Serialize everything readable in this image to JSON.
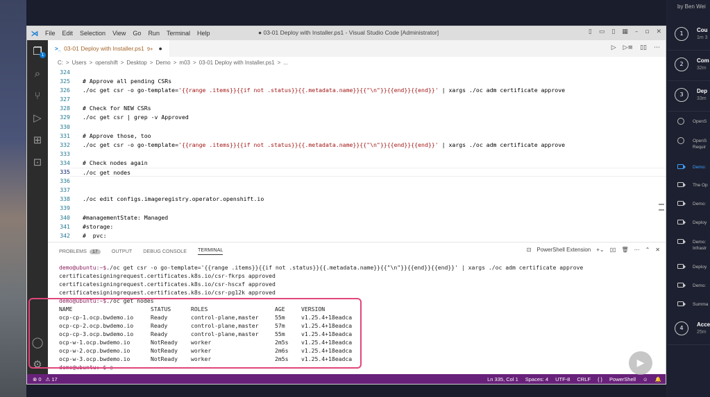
{
  "window": {
    "title": "● 03-01 Deploy with Installer.ps1 - Visual Studio Code [Administrator]",
    "menu": [
      "File",
      "Edit",
      "Selection",
      "View",
      "Go",
      "Run",
      "Terminal",
      "Help"
    ]
  },
  "tab": {
    "label": "03-01 Deploy with Installer.ps1",
    "problem_count": "9+",
    "modified_dot": "●"
  },
  "breadcrumb": [
    "C:",
    ">",
    "Users",
    ">",
    "openshift",
    ">",
    "Desktop",
    ">",
    "Demo",
    ">",
    "m03",
    ">",
    "03-01 Deploy with Installer.ps1",
    ">",
    "..."
  ],
  "editor": {
    "lines": [
      {
        "n": "324",
        "text": "",
        "kind": "plain"
      },
      {
        "n": "325",
        "text": "# Approve all pending CSRs",
        "kind": "comment"
      },
      {
        "n": "326",
        "pre": "./oc get csr -o go-template=",
        "str": "'{{range .items}}{{if not .status}}{{.metadata.name}}{{\"\\n\"}}{{end}}{{end}}'",
        "post": " | xargs ./oc adm certificate approve",
        "kind": "mixed"
      },
      {
        "n": "327",
        "text": "",
        "kind": "plain"
      },
      {
        "n": "328",
        "text": "# Check for NEW CSRs",
        "kind": "comment"
      },
      {
        "n": "329",
        "text": "./oc get csr | grep -v Approved",
        "kind": "plain"
      },
      {
        "n": "330",
        "text": "",
        "kind": "plain"
      },
      {
        "n": "331",
        "text": "# Approve those, too",
        "kind": "comment"
      },
      {
        "n": "332",
        "pre": "./oc get csr -o go-template=",
        "str": "'{{range .items}}{{if not .status}}{{.metadata.name}}{{\"\\n\"}}{{end}}{{end}}'",
        "post": " | xargs ./oc adm certificate approve",
        "kind": "mixed"
      },
      {
        "n": "333",
        "text": "",
        "kind": "plain"
      },
      {
        "n": "334",
        "text": "# Check nodes again",
        "kind": "comment"
      },
      {
        "n": "335",
        "text": "./oc get nodes",
        "kind": "plain",
        "current": true
      },
      {
        "n": "336",
        "text": "",
        "kind": "plain"
      },
      {
        "n": "337",
        "text": "",
        "kind": "plain"
      },
      {
        "n": "338",
        "text": "./oc edit configs.imageregistry.operator.openshift.io",
        "kind": "plain"
      },
      {
        "n": "339",
        "text": "",
        "kind": "plain"
      },
      {
        "n": "340",
        "text": "#managementState: Managed",
        "kind": "comment"
      },
      {
        "n": "341",
        "text": "#storage:",
        "kind": "comment"
      },
      {
        "n": "342",
        "text": "#  pvc:",
        "kind": "comment"
      }
    ]
  },
  "panel": {
    "tabs": [
      "PROBLEMS",
      "OUTPUT",
      "DEBUG CONSOLE",
      "TERMINAL"
    ],
    "problems_count": "17",
    "shell_label": "PowerShell Extension"
  },
  "terminal": {
    "cmd1": "./oc get csr -o go-template='{{range .items}}{{if not .status}}{{.metadata.name}}{{\"\\n\"}}{{end}}{{end}}' | xargs ./oc adm certificate approve",
    "prompt": "demo@ubuntu:~$",
    "approved": [
      "certificatesigningrequest.certificates.k8s.io/csr-fkrps approved",
      "certificatesigningrequest.certificates.k8s.io/csr-hscxf approved",
      "certificatesigningrequest.certificates.k8s.io/csr-pg12k approved"
    ],
    "cmd2": "./oc get nodes",
    "headers": [
      "NAME",
      "STATUS",
      "ROLES",
      "AGE",
      "VERSION"
    ],
    "rows": [
      [
        "ocp-cp-1.ocp.bwdemo.io",
        "Ready",
        "control-plane,master",
        "55m",
        "v1.25.4+18eadca"
      ],
      [
        "ocp-cp-2.ocp.bwdemo.io",
        "Ready",
        "control-plane,master",
        "57m",
        "v1.25.4+18eadca"
      ],
      [
        "ocp-cp-3.ocp.bwdemo.io",
        "Ready",
        "control-plane,master",
        "55m",
        "v1.25.4+18eadca"
      ],
      [
        "ocp-w-1.ocp.bwdemo.io",
        "NotReady",
        "worker",
        "2m5s",
        "v1.25.4+18eadca"
      ],
      [
        "ocp-w-2.ocp.bwdemo.io",
        "NotReady",
        "worker",
        "2m6s",
        "v1.25.4+18eadca"
      ],
      [
        "ocp-w-3.ocp.bwdemo.io",
        "NotReady",
        "worker",
        "2m5s",
        "v1.25.4+18eadca"
      ]
    ],
    "final_prompt": "demo@ubuntu:~$"
  },
  "statusbar": {
    "errors": "⊗ 0",
    "warnings": "⚠ 17",
    "position": "Ln 335, Col 1",
    "spaces": "Spaces: 4",
    "encoding": "UTF-8",
    "eol": "CRLF",
    "language": "{ }",
    "shell": "PowerShell"
  },
  "course": {
    "author": "by Ben Wei",
    "modules": [
      {
        "num": "1",
        "title": "Cou",
        "dur": "1m 3"
      },
      {
        "num": "2",
        "title": "Com",
        "dur": "32m"
      },
      {
        "num": "3",
        "title": "Dep",
        "dur": "33m"
      },
      {
        "num": "4",
        "title": "Acce",
        "dur": "25m"
      }
    ],
    "clips": [
      {
        "icon": "check",
        "label": "OpenS"
      },
      {
        "icon": "check",
        "label": "OpenS\nRequir"
      },
      {
        "icon": "video",
        "label": "Demo:",
        "active": true
      },
      {
        "icon": "video",
        "label": "The Op"
      },
      {
        "icon": "video",
        "label": "Demo:"
      },
      {
        "icon": "video",
        "label": "Deploy"
      },
      {
        "icon": "video",
        "label": "Demo:\nInfrastr"
      },
      {
        "icon": "video",
        "label": "Deploy"
      },
      {
        "icon": "video",
        "label": "Demo:"
      },
      {
        "icon": "video",
        "label": "Summa"
      }
    ]
  },
  "colors": {
    "statusbar": "#68217a",
    "highlight": "#e0457a",
    "prompt": "#8a1f5f",
    "accent": "#0b7ad3"
  }
}
